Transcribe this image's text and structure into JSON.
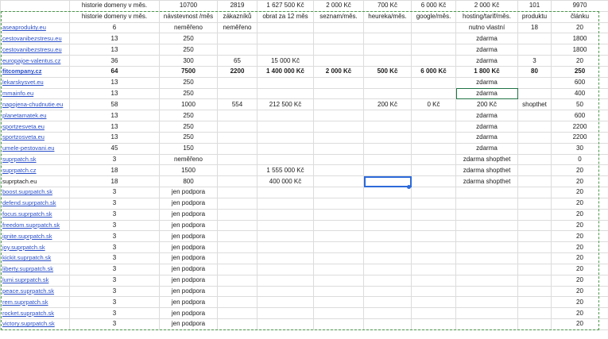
{
  "totals": [
    "",
    "historie domeny v měs.",
    "10700",
    "2819",
    "1 627 500 Kč",
    "2 000 Kč",
    "700 Kč",
    "6 000 Kč",
    "2 000 Kč",
    "101",
    "9970"
  ],
  "headers": [
    "",
    "historie domeny v měs.",
    "návstevnost /měs",
    "zákazníků",
    "obrat za 12 měs",
    "seznam/měs.",
    "heureka/měs.",
    "google/měs.",
    "hosting/tarif/měs.",
    "produktu",
    "článku"
  ],
  "rows": [
    [
      "aseaprodukty.eu",
      "6",
      "neměřeno",
      "neměřeno",
      "",
      "",
      "",
      "",
      "nutno vlastní",
      "18",
      "20"
    ],
    [
      "cestovanibezstresu.eu",
      "13",
      "250",
      "",
      "",
      "",
      "",
      "",
      "zdarma",
      "",
      "1800"
    ],
    [
      "cestovanibezstresu.eu",
      "13",
      "250",
      "",
      "",
      "",
      "",
      "",
      "zdarma",
      "",
      "1800"
    ],
    [
      "europajoe-valentus.cz",
      "36",
      "300",
      "65",
      "15 000 Kč",
      "",
      "",
      "",
      "zdarma",
      "3",
      "20"
    ],
    [
      "fitcompany.cz",
      "64",
      "7500",
      "2200",
      "1 400 000 Kč",
      "2 000 Kč",
      "500 Kč",
      "6 000 Kč",
      "1 800 Kč",
      "80",
      "250"
    ],
    [
      "lekarskysvet.eu",
      "13",
      "250",
      "",
      "",
      "",
      "",
      "",
      "zdarma",
      "",
      "600"
    ],
    [
      "mmainfo.eu",
      "13",
      "250",
      "",
      "",
      "",
      "",
      "",
      "zdarma",
      "",
      "400"
    ],
    [
      "napojena-chudnutie.eu",
      "58",
      "1000",
      "554",
      "212 500 Kč",
      "",
      "200 Kč",
      "0 Kč",
      "200 Kč",
      "shopthet",
      "50"
    ],
    [
      "planetamatek.eu",
      "13",
      "250",
      "",
      "",
      "",
      "",
      "",
      "zdarma",
      "",
      "600"
    ],
    [
      "sportzesveta.eu",
      "13",
      "250",
      "",
      "",
      "",
      "",
      "",
      "zdarma",
      "",
      "2200"
    ],
    [
      "sportzosveta.eu",
      "13",
      "250",
      "",
      "",
      "",
      "",
      "",
      "zdarma",
      "",
      "2200"
    ],
    [
      "umele-pestovani.eu",
      "45",
      "150",
      "",
      "",
      "",
      "",
      "",
      "zdarma",
      "",
      "30"
    ],
    [
      "suprpatch.sk",
      "3",
      "neměřeno",
      "",
      "",
      "",
      "",
      "",
      "zdarma shopthet",
      "",
      "0"
    ],
    [
      "suprpatch.cz",
      "18",
      "1500",
      "",
      "1 555 000 Kč",
      "",
      "",
      "",
      "zdarma shopthet",
      "",
      "20"
    ],
    [
      "suprptach.eu",
      "18",
      "800",
      "",
      "400 000 Kč",
      "",
      "",
      "",
      "zdarma shopthet",
      "",
      "20"
    ],
    [
      "boost.suprpatch.sk",
      "3",
      "jen podpora",
      "",
      "",
      "",
      "",
      "",
      "",
      "",
      "20"
    ],
    [
      "defend.suprpatch.sk",
      "3",
      "jen podpora",
      "",
      "",
      "",
      "",
      "",
      "",
      "",
      "20"
    ],
    [
      "focus.suprpatch.sk",
      "3",
      "jen podpora",
      "",
      "",
      "",
      "",
      "",
      "",
      "",
      "20"
    ],
    [
      "freedom.suprpatch.sk",
      "3",
      "jen podpora",
      "",
      "",
      "",
      "",
      "",
      "",
      "",
      "20"
    ],
    [
      "ignite.suprpatch.sk",
      "3",
      "jen podpora",
      "",
      "",
      "",
      "",
      "",
      "",
      "",
      "20"
    ],
    [
      "joy.suprpatch.sk",
      "3",
      "jen podpora",
      "",
      "",
      "",
      "",
      "",
      "",
      "",
      "20"
    ],
    [
      "kickit.suprpatch.sk",
      "3",
      "jen podpora",
      "",
      "",
      "",
      "",
      "",
      "",
      "",
      "20"
    ],
    [
      "liberty.suprpatch.sk",
      "3",
      "jen podpora",
      "",
      "",
      "",
      "",
      "",
      "",
      "",
      "20"
    ],
    [
      "lumi.suprpatch.sk",
      "3",
      "jen podpora",
      "",
      "",
      "",
      "",
      "",
      "",
      "",
      "20"
    ],
    [
      "peace.suprpatch.sk",
      "3",
      "jen podpora",
      "",
      "",
      "",
      "",
      "",
      "",
      "",
      "20"
    ],
    [
      "rem.suprpatch.sk",
      "3",
      "jen podpora",
      "",
      "",
      "",
      "",
      "",
      "",
      "",
      "20"
    ],
    [
      "rocket.suprpatch.sk",
      "3",
      "jen podpora",
      "",
      "",
      "",
      "",
      "",
      "",
      "",
      "20"
    ],
    [
      "victory.suprpatch.sk",
      "3",
      "jen podpora",
      "",
      "",
      "",
      "",
      "",
      "",
      "",
      "20"
    ]
  ],
  "row_styles": {
    "linked_rows": [
      0,
      1,
      2,
      3,
      4,
      5,
      6,
      7,
      8,
      9,
      10,
      11,
      12,
      13,
      15,
      16,
      17,
      18,
      19,
      20,
      21,
      22,
      23,
      24,
      25,
      26,
      27
    ],
    "bold_row": 4
  },
  "colors": {
    "link": "#2a4fc9",
    "gridline": "#dcdcdc",
    "copy_marquee": "#4a9a4a",
    "selection": "#2d6ad9"
  }
}
